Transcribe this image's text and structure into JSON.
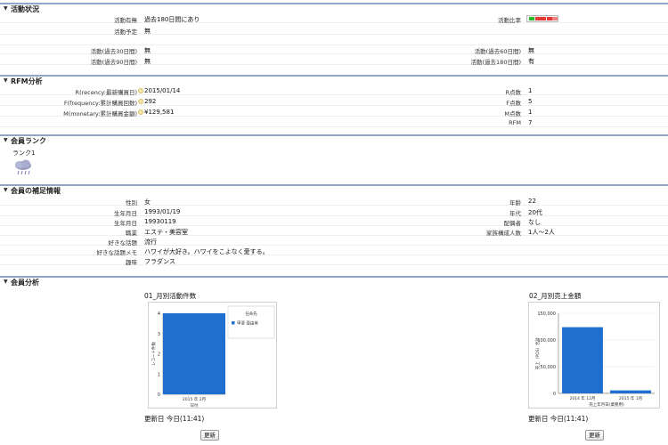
{
  "activity": {
    "title": "活動状況",
    "rows": [
      {
        "l1": "活動有無",
        "v1": "過去180日間にあり",
        "l2": "活動比率",
        "v2": ""
      },
      {
        "l1": "活動予定",
        "v1": "無",
        "l2": "",
        "v2": ""
      },
      {
        "l1": "",
        "v1": "",
        "l2": "",
        "v2": ""
      },
      {
        "l1": "活動(過去30日間)",
        "v1": "無",
        "l2": "活動(過去60日間)",
        "v2": "無"
      },
      {
        "l1": "活動(過去90日間)",
        "v1": "無",
        "l2": "活動(過去180日間)",
        "v2": "有"
      }
    ],
    "rate_colors": [
      "#2eb82e",
      "#e53935",
      "#e53935",
      "#e53935",
      "#f08080"
    ]
  },
  "rfm": {
    "title": "RFM分析",
    "rows": [
      {
        "l1": "R(recency:最新購買日)",
        "v1": "2015/01/14",
        "l2": "R点数",
        "v2": "1"
      },
      {
        "l1": "F(frequency:累計購買回数)",
        "v1": "292",
        "l2": "F点数",
        "v2": "5"
      },
      {
        "l1": "M(monetary:累計購買金額)",
        "v1": "¥129,581",
        "l2": "M点数",
        "v2": "1"
      },
      {
        "l1": "",
        "v1": "",
        "l2": "RFM",
        "v2": "7"
      }
    ]
  },
  "rank": {
    "title": "会員ランク",
    "label": "ランク1",
    "icon": "cloud-rain-icon"
  },
  "supplement": {
    "title": "会員の補足情報",
    "rows": [
      {
        "l1": "性別",
        "v1": "女",
        "l2": "年齢",
        "v2": "22"
      },
      {
        "l1": "生年月日",
        "v1": "1993/01/19",
        "l2": "年代",
        "v2": "20代"
      },
      {
        "l1": "生年月日",
        "v1": "19930119",
        "l2": "配偶者",
        "v2": "なし"
      },
      {
        "l1": "職業",
        "v1": "エステ・美容室",
        "l2": "家族構成人数",
        "v2": "1人～2人"
      },
      {
        "l1": "好きな話題",
        "v1": "流行",
        "l2": "",
        "v2": ""
      },
      {
        "l1": "好きな話題メモ",
        "v1": "ハワイが大好き。ハワイをこよなく愛する。",
        "l2": "",
        "v2": ""
      },
      {
        "l1": "趣味",
        "v1": "フラダンス",
        "l2": "",
        "v2": ""
      }
    ]
  },
  "analysis": {
    "title": "会員分析",
    "update_label": "更新日 今日(11:41)",
    "button_label": "更新"
  },
  "chart_data": [
    {
      "type": "bar",
      "title": "01_月別活動件数",
      "categories": [
        "2015 年 2月"
      ],
      "series": [
        {
          "name": "甲斐 亜由美",
          "values": [
            4
          ]
        }
      ],
      "xlabel": "日付",
      "ylabel": "レコード件数",
      "legend_title": "任命先",
      "yticks": [
        "0",
        "1",
        "2",
        "3",
        "4"
      ],
      "ylim": [
        0,
        4
      ],
      "color": "#1f6fd1"
    },
    {
      "type": "bar",
      "title": "02_月別売上金額",
      "categories": [
        "2014 年 12月",
        "2015 年 1月"
      ],
      "series": [
        {
          "values": [
            124000,
            5600
          ]
        }
      ],
      "xlabel": "売上年月日(業務用)",
      "ylabel": "売上（POS）合計",
      "yticks": [
        "0",
        "50,000",
        "100,000",
        "150,000"
      ],
      "ylim": [
        0,
        150000
      ],
      "color": "#1f6fd1"
    }
  ]
}
